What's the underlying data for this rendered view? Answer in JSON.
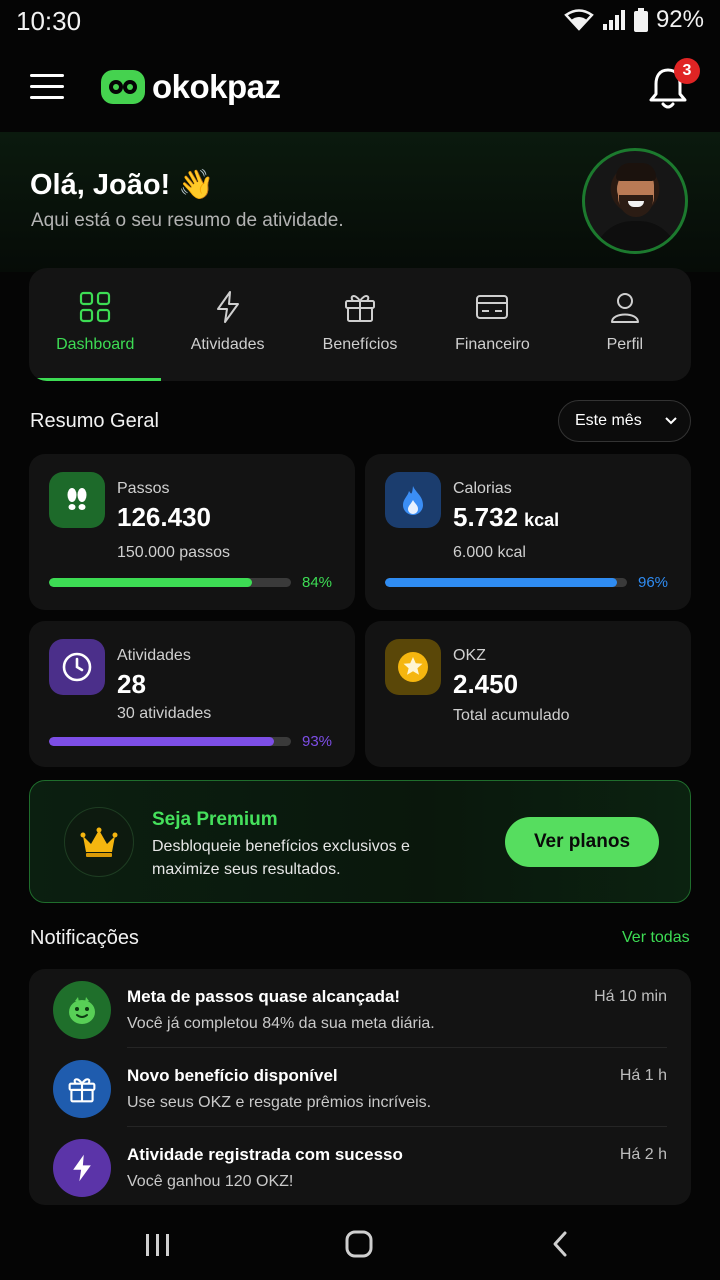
{
  "status_bar": {
    "time": "10:30",
    "battery": "92%"
  },
  "app": {
    "brand": "okokpaz",
    "notification_count": "3"
  },
  "hero": {
    "greeting": "Olá, João! 👋",
    "subtitle": "Aqui está o seu resumo de atividade."
  },
  "tabs": [
    {
      "label": "Dashboard",
      "icon": "grid-icon",
      "active": true
    },
    {
      "label": "Atividades",
      "icon": "bolt-icon",
      "active": false
    },
    {
      "label": "Benefícios",
      "icon": "gift-icon",
      "active": false
    },
    {
      "label": "Financeiro",
      "icon": "card-icon",
      "active": false
    },
    {
      "label": "Perfil",
      "icon": "user-icon",
      "active": false
    }
  ],
  "summary": {
    "title": "Resumo Geral",
    "period": "Este mês",
    "cards": [
      {
        "label": "Passos",
        "value": "126.430",
        "unit": "",
        "sub": "150.000 passos",
        "percent_label": "84%",
        "percent": 84,
        "color": "#3ddc54",
        "icon": "footsteps-icon"
      },
      {
        "label": "Calorias",
        "value": "5.732",
        "unit": "kcal",
        "sub": "6.000 kcal",
        "percent_label": "96%",
        "percent": 96,
        "color": "#2f8cf2",
        "icon": "flame-icon"
      },
      {
        "label": "Atividades",
        "value": "28",
        "unit": "",
        "sub": "30 atividades",
        "percent_label": "93%",
        "percent": 93,
        "color": "#7d4ee6",
        "icon": "clock-icon"
      },
      {
        "label": "OKZ",
        "value": "2.450",
        "unit": "",
        "sub": "Total acumulado",
        "icon": "star-coin-icon"
      }
    ]
  },
  "premium": {
    "title": "Seja Premium",
    "text": "Desbloqueie benefícios exclusivos e maximize seus resultados.",
    "button": "Ver planos"
  },
  "notifications": {
    "title": "Notificações",
    "see_all": "Ver todas",
    "items": [
      {
        "title": "Meta de passos quase alcançada!",
        "body": "Você já completou 84% da sua meta diária.",
        "time": "Há 10 min",
        "icon": "mascot-icon"
      },
      {
        "title": "Novo benefício disponível",
        "body": "Use seus OKZ e resgate prêmios incríveis.",
        "time": "Há 1 h",
        "icon": "gift-icon"
      },
      {
        "title": "Atividade registrada com sucesso",
        "body": "Você ganhou 120 OKZ!",
        "time": "Há 2 h",
        "icon": "bolt-icon"
      }
    ]
  },
  "colors": {
    "accent": "#3ddc54",
    "background": "#050505",
    "card": "#131313"
  }
}
